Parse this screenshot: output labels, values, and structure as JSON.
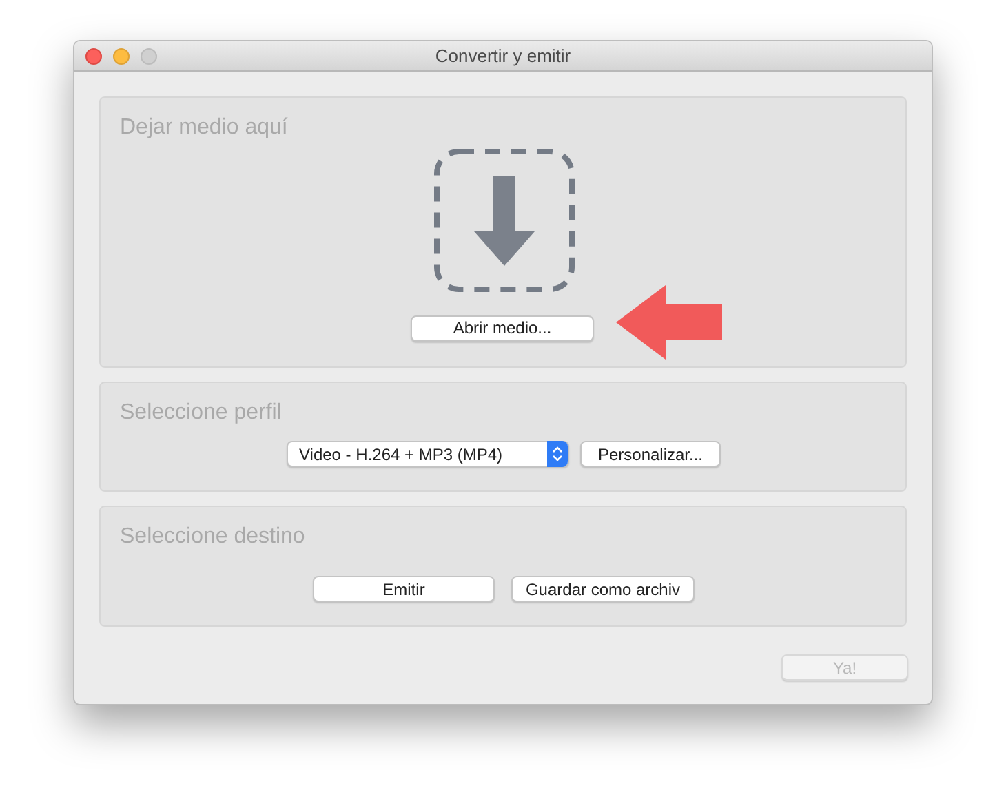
{
  "window": {
    "title": "Convertir y emitir"
  },
  "drop_section": {
    "title": "Dejar medio aquí",
    "open_button": "Abrir medio..."
  },
  "profile_section": {
    "title": "Seleccione perfil",
    "profile_select": "Video - H.264 + MP3 (MP4)",
    "customize_button": "Personalizar..."
  },
  "destination_section": {
    "title": "Seleccione destino",
    "buttons": [
      {
        "label": "Emitir"
      },
      {
        "label": "Guardar como archiv"
      }
    ]
  },
  "footer": {
    "go_button": {
      "label": "Ya!",
      "disabled": true
    }
  }
}
